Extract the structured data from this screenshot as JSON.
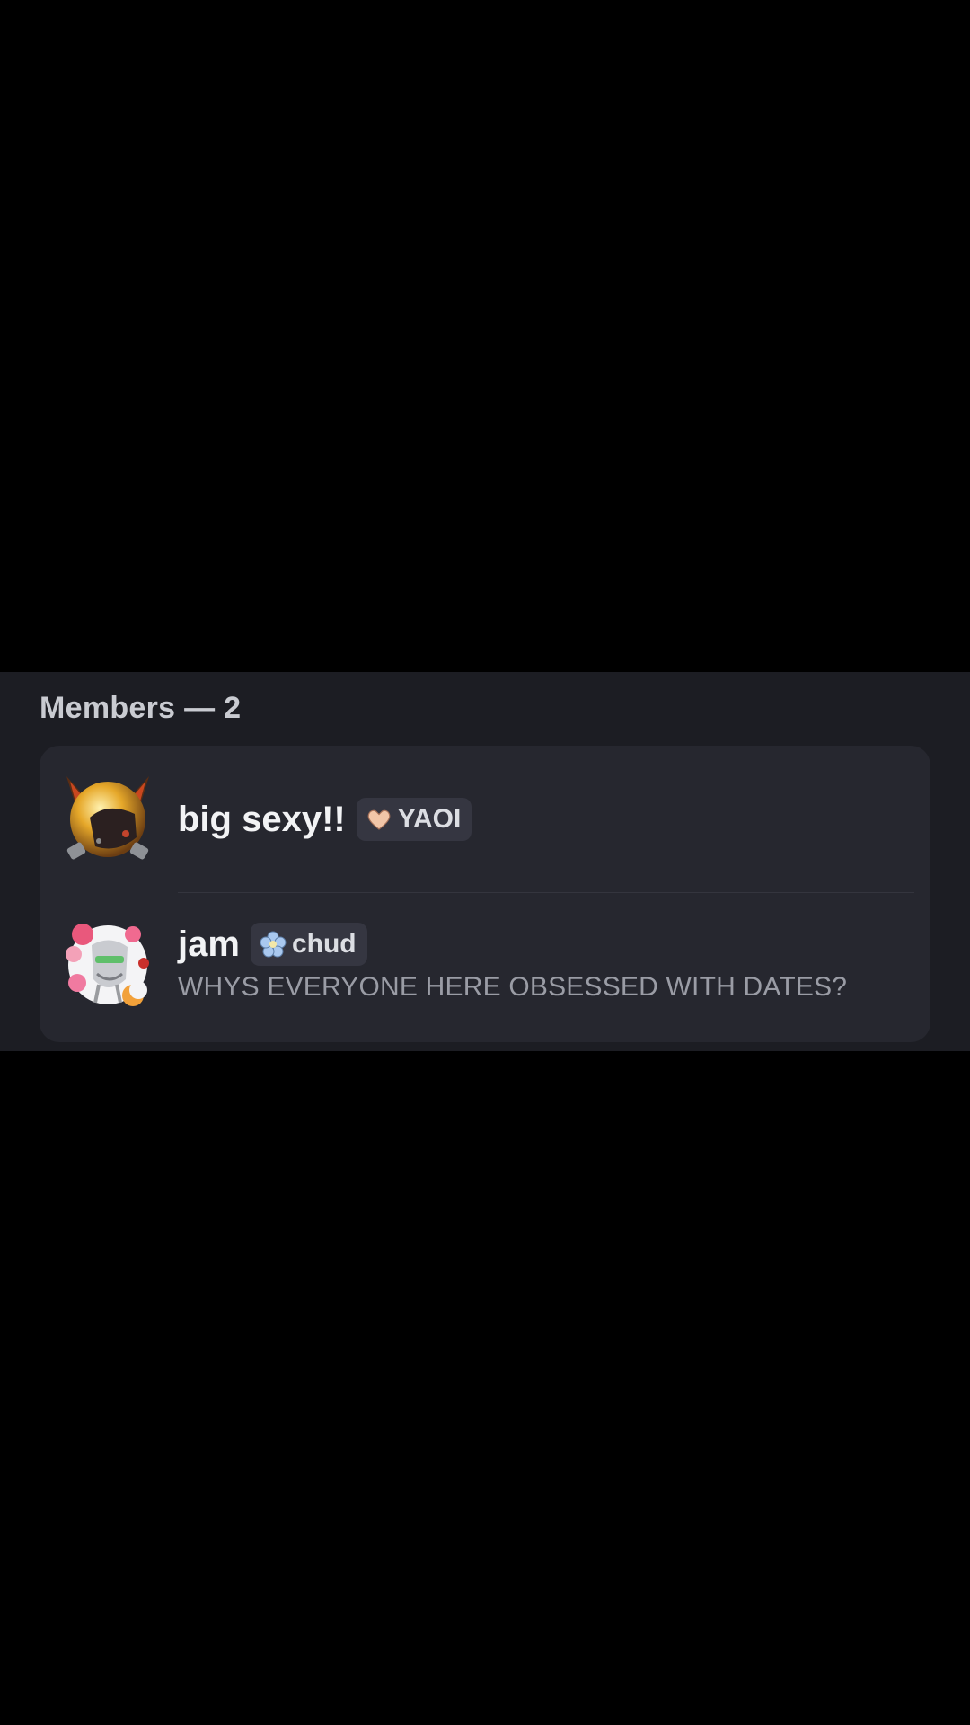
{
  "members_section": {
    "header": "Members — 2",
    "members": [
      {
        "name": "big sexy!!",
        "avatar_icon": "cat-ears-avatar-icon",
        "tag": {
          "icon": "heart-icon",
          "icon_color": "#f2c6a8",
          "label": "YAOI"
        }
      },
      {
        "name": "jam",
        "avatar_icon": "robot-hearts-avatar-icon",
        "tag": {
          "icon": "flower-icon",
          "icon_color": "#a9c8ef",
          "label": "chud"
        },
        "status": "WHYS EVERYONE HERE OBSESSED WITH DATES?"
      }
    ]
  },
  "colors": {
    "background": "#000000",
    "panel": "#1c1d23",
    "card": "#26272f",
    "tag_background": "#353641",
    "name_text": "#f2f3f5",
    "status_text": "#9a9ca5"
  }
}
